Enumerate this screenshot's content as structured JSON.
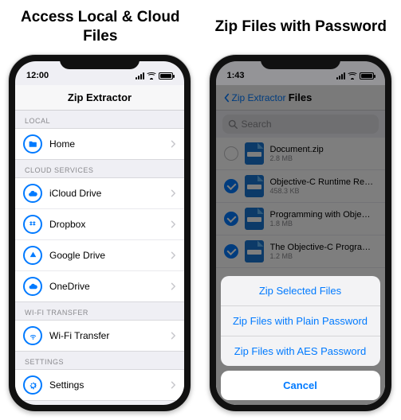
{
  "captions": {
    "left": "Access Local & Cloud Files",
    "right": "Zip Files with Password"
  },
  "statusbar": {
    "time_left": "12:00",
    "time_right": "1:43"
  },
  "colors": {
    "accent": "#007aff"
  },
  "left_screen": {
    "title": "Zip Extractor",
    "sections": [
      {
        "header": "LOCAL",
        "items": [
          {
            "label": "Home",
            "icon": "folder-icon",
            "color": "#007aff"
          }
        ]
      },
      {
        "header": "CLOUD SERVICES",
        "items": [
          {
            "label": "iCloud Drive",
            "icon": "cloud-icon",
            "color": "#007aff"
          },
          {
            "label": "Dropbox",
            "icon": "dropbox-icon",
            "color": "#007aff"
          },
          {
            "label": "Google Drive",
            "icon": "gdrive-icon",
            "color": "#007aff"
          },
          {
            "label": "OneDrive",
            "icon": "onedrive-icon",
            "color": "#007aff"
          }
        ]
      },
      {
        "header": "WI-FI TRANSFER",
        "items": [
          {
            "label": "Wi-Fi Transfer",
            "icon": "wifi-icon",
            "color": "#007aff"
          }
        ]
      },
      {
        "header": "SETTINGS",
        "items": [
          {
            "label": "Settings",
            "icon": "gear-icon",
            "color": "#007aff"
          }
        ]
      }
    ]
  },
  "right_screen": {
    "back_label": "Zip Extractor",
    "title": "Files",
    "search_placeholder": "Search",
    "files": [
      {
        "name": "Document.zip",
        "meta": "2.8 MB",
        "selected": false
      },
      {
        "name": "Objective-C Runtime Refe…",
        "meta": "458.3 KB",
        "selected": true
      },
      {
        "name": "Programming with Objecti…",
        "meta": "1.8 MB",
        "selected": true
      },
      {
        "name": "The Objective-C Program…",
        "meta": "1.2 MB",
        "selected": true
      }
    ],
    "sheet": {
      "actions": [
        "Zip Selected Files",
        "Zip Files with Plain Password",
        "Zip Files with AES Password"
      ],
      "cancel": "Cancel"
    }
  }
}
